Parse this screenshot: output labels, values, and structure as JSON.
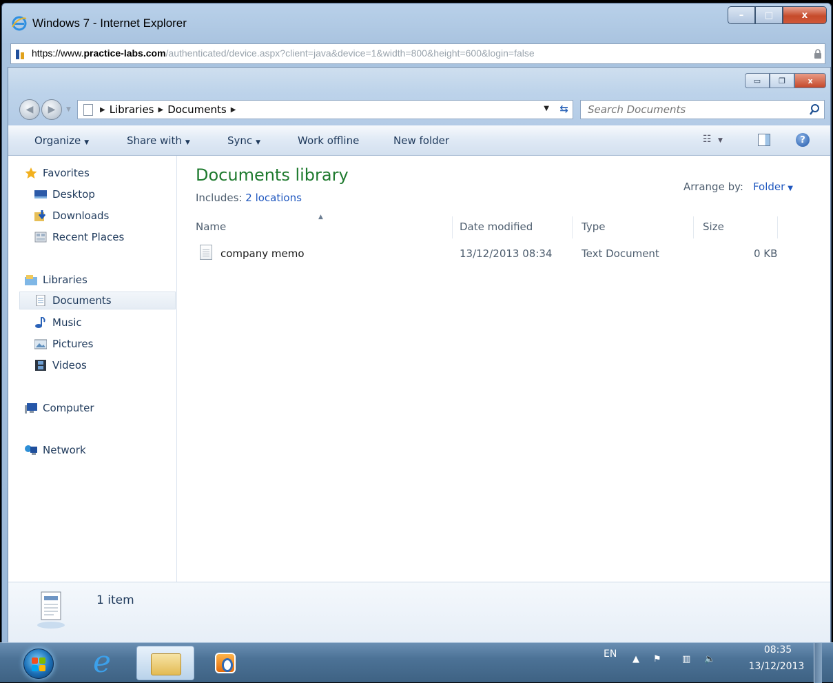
{
  "ie": {
    "title": "Windows 7 - Internet Explorer",
    "url_scheme": "https://www.",
    "url_domain": "practice-labs.com",
    "url_path": "/authenticated/device.aspx?client=java&device=1&width=800&height=600&login=false",
    "minimize": "–",
    "maximize": "□",
    "close": "x"
  },
  "explorer": {
    "caption": {
      "minimize": "▭",
      "restore": "❐",
      "close": "x"
    },
    "breadcrumb": [
      "Libraries",
      "Documents"
    ],
    "search_placeholder": "Search Documents",
    "toolbar": {
      "organize": "Organize",
      "share_with": "Share with",
      "sync": "Sync",
      "work_offline": "Work offline",
      "new_folder": "New folder",
      "help": "?"
    },
    "nav": {
      "favorites": "Favorites",
      "desktop": "Desktop",
      "downloads": "Downloads",
      "recent_places": "Recent Places",
      "libraries": "Libraries",
      "documents": "Documents",
      "music": "Music",
      "pictures": "Pictures",
      "videos": "Videos",
      "computer": "Computer",
      "network": "Network"
    },
    "library": {
      "title": "Documents library",
      "includes_label": "Includes:",
      "includes_link": "2 locations",
      "arrange_label": "Arrange by:",
      "arrange_value": "Folder"
    },
    "columns": {
      "name": "Name",
      "date": "Date modified",
      "type": "Type",
      "size": "Size"
    },
    "files": [
      {
        "name": "company memo",
        "date": "13/12/2013 08:34",
        "type": "Text Document",
        "size": "0 KB"
      }
    ],
    "details": {
      "count": "1 item"
    }
  },
  "taskbar": {
    "ie_glyph": "e",
    "lang": "EN",
    "time": "08:35",
    "date": "13/12/2013"
  },
  "colors": {
    "library_title": "#1e7a2e",
    "link": "#1f57bf",
    "taskbar": "#4c7296"
  }
}
